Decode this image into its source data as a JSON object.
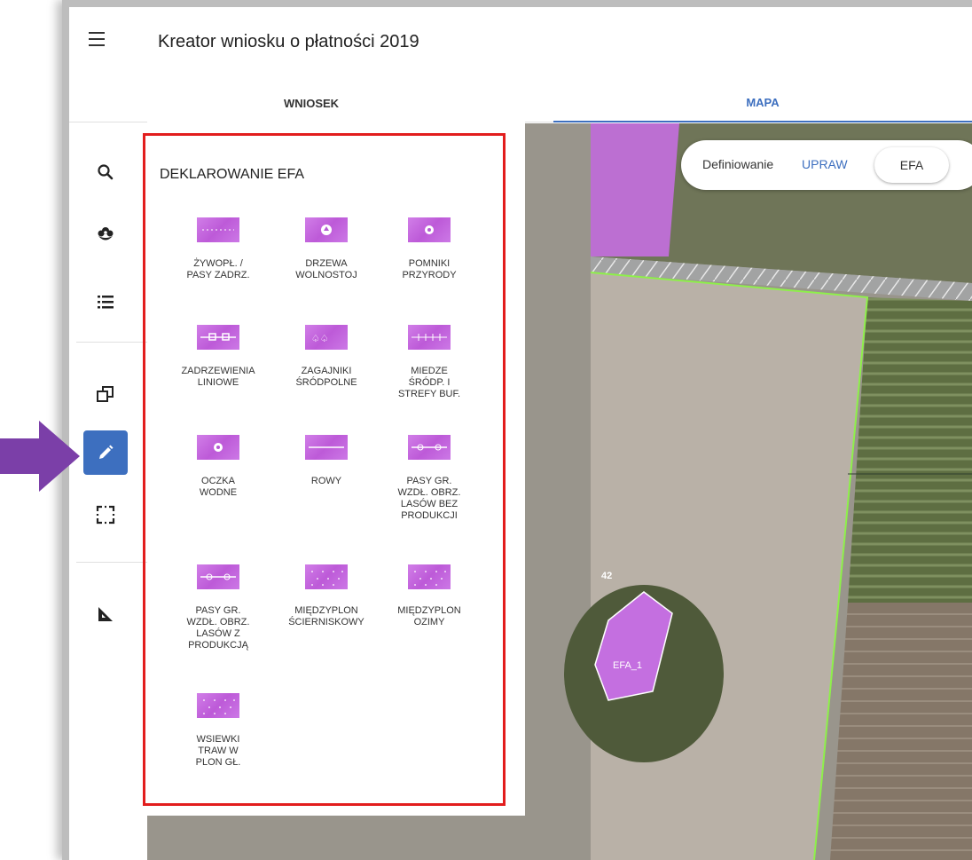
{
  "header": {
    "title": "Kreator wniosku o płatności 2019"
  },
  "tabs": [
    {
      "label": "WNIOSEK"
    },
    {
      "label": "MAPA"
    }
  ],
  "rail": {
    "items": [
      {
        "icon": "search-icon"
      },
      {
        "icon": "plant-icon"
      },
      {
        "icon": "list-icon"
      },
      {
        "icon": "copy-icon"
      },
      {
        "icon": "pencil-icon"
      },
      {
        "icon": "select-area-icon"
      },
      {
        "icon": "ruler-icon"
      }
    ]
  },
  "pill": {
    "label": "Definiowanie",
    "upraw": "UPRAW",
    "efa": "EFA"
  },
  "panel": {
    "title": "DEKLAROWANIE EFA",
    "items": [
      {
        "label": "ŻYWOPŁ. /\nPASY ZADRZ."
      },
      {
        "label": "DRZEWA\nWOLNOSTOJ"
      },
      {
        "label": "POMNIKI\nPRZYRODY"
      },
      {
        "label": "ZADRZEWIENIA\nLINIOWE"
      },
      {
        "label": "ZAGAJNIKI\nŚRÓDPOLNE"
      },
      {
        "label": "MIEDZE\nŚRÓDP. I\nSTREFY BUF."
      },
      {
        "label": "OCZKA\nWODNE"
      },
      {
        "label": "ROWY"
      },
      {
        "label": "PASY GR.\nWZDŁ. OBRZ.\nLASÓW BEZ\nPRODUKCJI"
      },
      {
        "label": "PASY GR.\nWZDŁ. OBRZ.\nLASÓW Z\nPRODUKCJĄ"
      },
      {
        "label": "MIĘDZYPLON\nŚCIERNISKOWY"
      },
      {
        "label": "MIĘDZYPLON\nOZIMY"
      },
      {
        "label": "WSIEWKI\nTRAW W\nPLON GŁ."
      }
    ]
  },
  "map": {
    "parcel_number": "42",
    "efa_label": "EFA_1"
  },
  "colors": {
    "accent": "#3d6fbf",
    "efa_purple": "#c46fe0",
    "highlight_border": "#e21d1d",
    "arrow": "#7b3fa8",
    "parcel_outline": "#8ef04a"
  }
}
